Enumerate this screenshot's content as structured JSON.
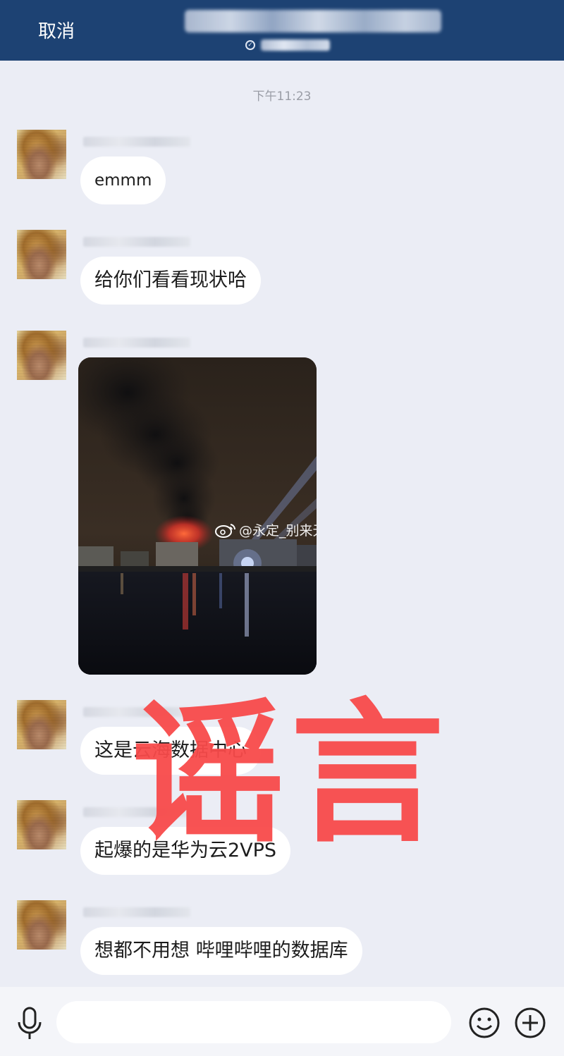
{
  "header": {
    "cancel_label": "取消",
    "colors": {
      "bar": "#1d4273",
      "text": "#ffffff"
    }
  },
  "chat": {
    "timestamp": "下午11:23",
    "messages": [
      {
        "type": "text",
        "text": "emmm"
      },
      {
        "type": "text",
        "text": "给你们看看现状哈"
      },
      {
        "type": "image",
        "image_description_icon": "photo-night-fire",
        "watermark": "@永定_别来无恙"
      },
      {
        "type": "text",
        "text": "这是云海数据中心"
      },
      {
        "type": "text",
        "text": "起爆的是华为云2VPS"
      },
      {
        "type": "text",
        "text": "想都不用想 哔哩哔哩的数据库"
      }
    ]
  },
  "overlay": {
    "stamp_text": "谣言",
    "color": "#f84a4a"
  },
  "composer": {
    "input_value": "",
    "icons": [
      "microphone-icon",
      "emoji-icon",
      "plus-icon"
    ]
  }
}
